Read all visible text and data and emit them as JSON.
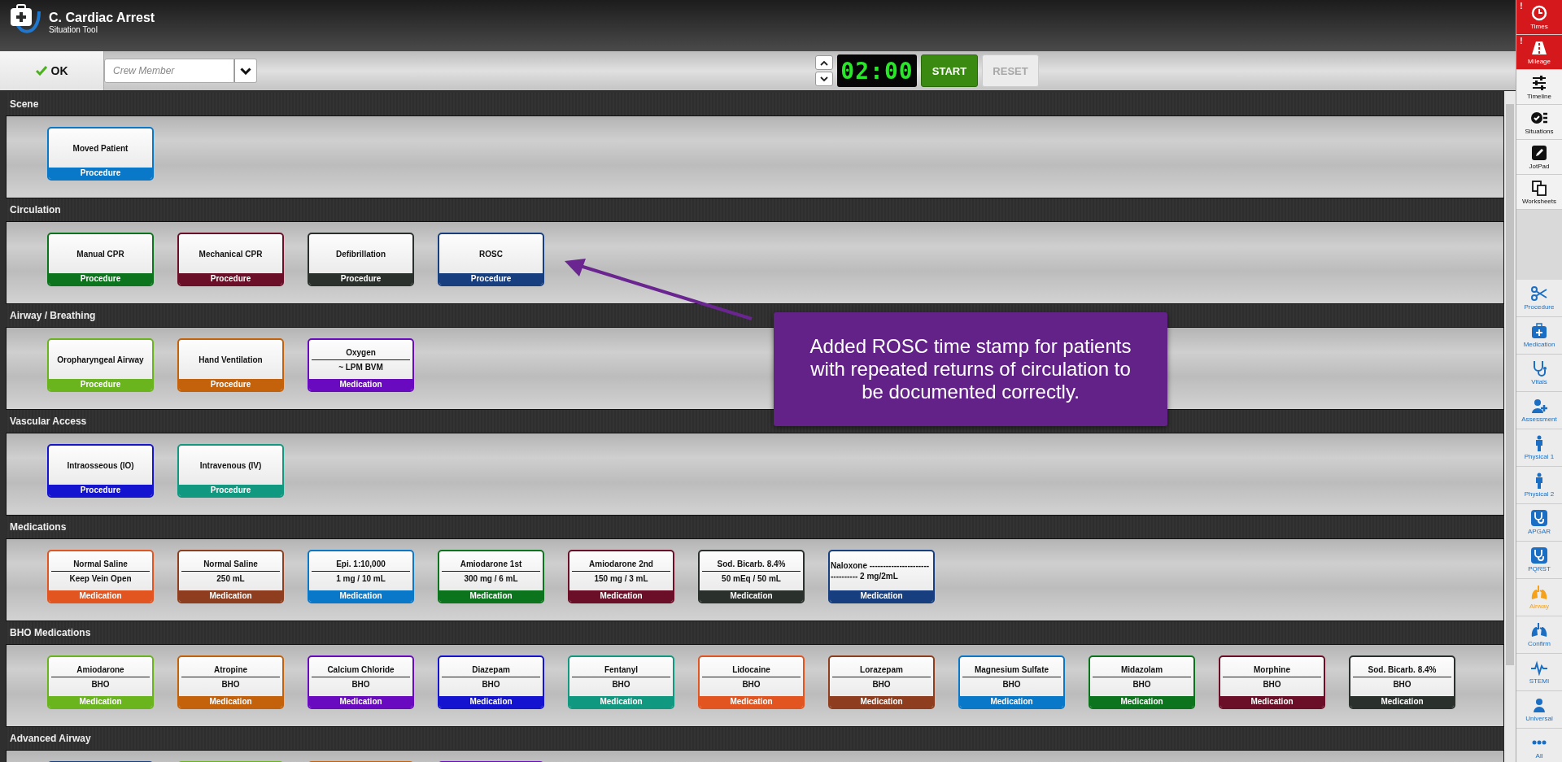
{
  "header": {
    "title": "C. Cardiac Arrest",
    "subtitle": "Situation Tool"
  },
  "toolbar": {
    "ok_button": "OK",
    "crew_field": {
      "placeholder": "Crew Member"
    },
    "timer": {
      "display": "02:00",
      "start": {
        "label": "START",
        "disabled": false
      },
      "reset": {
        "label": "RESET",
        "disabled": true
      }
    }
  },
  "sections": [
    {
      "title": "Scene",
      "cards": [
        {
          "kind": "single",
          "name": "Moved Patient",
          "type": "Procedure",
          "color": "#0a78c8"
        }
      ]
    },
    {
      "title": "Circulation",
      "cards": [
        {
          "kind": "single",
          "name": "Manual CPR",
          "type": "Procedure",
          "color": "#0c741c"
        },
        {
          "kind": "single",
          "name": "Mechanical CPR",
          "type": "Procedure",
          "color": "#6a0f27"
        },
        {
          "kind": "single",
          "name": "Defibrillation",
          "type": "Procedure",
          "color": "#2a302c"
        },
        {
          "kind": "single",
          "name": "ROSC",
          "type": "Procedure",
          "color": "#173f80"
        }
      ]
    },
    {
      "title": "Airway / Breathing",
      "cards": [
        {
          "kind": "single",
          "name": "Oropharyngeal Airway",
          "type": "Procedure",
          "color": "#6ab41e"
        },
        {
          "kind": "single",
          "name": "Hand Ventilation",
          "type": "Procedure",
          "color": "#c4620c"
        },
        {
          "kind": "dose",
          "name": "Oxygen",
          "dose": "~ LPM BVM",
          "type": "Medication",
          "color": "#6a0ac0"
        }
      ]
    },
    {
      "title": "Vascular Access",
      "cards": [
        {
          "kind": "single",
          "name": "Intraosseous (IO)",
          "type": "Procedure",
          "color": "#1414d0"
        },
        {
          "kind": "single",
          "name": "Intravenous (IV)",
          "type": "Procedure",
          "color": "#119880"
        }
      ]
    },
    {
      "title": "Medications",
      "cards": [
        {
          "kind": "dose",
          "name": "Normal Saline",
          "dose": "Keep Vein Open",
          "type": "Medication",
          "color": "#e25520"
        },
        {
          "kind": "dose",
          "name": "Normal Saline",
          "dose": "250 mL",
          "type": "Medication",
          "color": "#8e3e1e"
        },
        {
          "kind": "dose",
          "name": "Epi. 1:10,000",
          "dose": "1 mg / 10 mL",
          "type": "Medication",
          "color": "#0a78c8"
        },
        {
          "kind": "dose",
          "name": "Amiodarone 1st",
          "dose": "300 mg / 6 mL",
          "type": "Medication",
          "color": "#0c741c"
        },
        {
          "kind": "dose",
          "name": "Amiodarone 2nd",
          "dose": "150 mg / 3 mL",
          "type": "Medication",
          "color": "#6a0f27"
        },
        {
          "kind": "dose",
          "name": "Sod. Bicarb. 8.4%",
          "dose": "50 mEq / 50 mL",
          "type": "Medication",
          "color": "#2a302c"
        },
        {
          "kind": "lines",
          "name": "Naloxone ----------------------",
          "dose": "---------- 2 mg/2mL",
          "type": "Medication",
          "color": "#173f80"
        }
      ]
    },
    {
      "title": "BHO Medications",
      "cards": [
        {
          "kind": "dose",
          "name": "Amiodarone",
          "dose": "BHO",
          "type": "Medication",
          "color": "#6ab41e"
        },
        {
          "kind": "dose",
          "name": "Atropine",
          "dose": "BHO",
          "type": "Medication",
          "color": "#c4620c"
        },
        {
          "kind": "dose",
          "name": "Calcium Chloride",
          "dose": "BHO",
          "type": "Medication",
          "color": "#6a0ac0"
        },
        {
          "kind": "dose",
          "name": "Diazepam",
          "dose": "BHO",
          "type": "Medication",
          "color": "#1414d0"
        },
        {
          "kind": "dose",
          "name": "Fentanyl",
          "dose": "BHO",
          "type": "Medication",
          "color": "#119880"
        },
        {
          "kind": "dose",
          "name": "Lidocaine",
          "dose": "BHO",
          "type": "Medication",
          "color": "#e25520"
        },
        {
          "kind": "dose",
          "name": "Lorazepam",
          "dose": "BHO",
          "type": "Medication",
          "color": "#8e3e1e"
        },
        {
          "kind": "dose",
          "name": "Magnesium Sulfate",
          "dose": "BHO",
          "type": "Medication",
          "color": "#0a78c8"
        },
        {
          "kind": "dose",
          "name": "Midazolam",
          "dose": "BHO",
          "type": "Medication",
          "color": "#0c741c"
        },
        {
          "kind": "dose",
          "name": "Morphine",
          "dose": "BHO",
          "type": "Medication",
          "color": "#6a0f27"
        },
        {
          "kind": "dose",
          "name": "Sod. Bicarb. 8.4%",
          "dose": "BHO",
          "type": "Medication",
          "color": "#2a302c"
        }
      ]
    },
    {
      "title": "Advanced Airway",
      "cards": [
        {
          "kind": "stub",
          "color": "#173f80"
        },
        {
          "kind": "stub",
          "color": "#6ab41e"
        },
        {
          "kind": "stub",
          "color": "#c4620c"
        },
        {
          "kind": "stub",
          "color": "#6a0ac0"
        }
      ]
    }
  ],
  "callout": {
    "text": "Added ROSC time stamp for patients with repeated returns of circulation to be documented correctly."
  },
  "sidebar": {
    "top_items": [
      {
        "label": "Times",
        "alert": true,
        "badge": "!"
      },
      {
        "label": "Mileage",
        "alert": true,
        "badge": "!"
      },
      {
        "label": "Timeline",
        "alert": false
      },
      {
        "label": "Situations",
        "alert": false
      },
      {
        "label": "JotPad",
        "alert": false
      },
      {
        "label": "Worksheets",
        "alert": false
      }
    ],
    "tool_items": [
      {
        "label": "Procedure",
        "highlighted": false
      },
      {
        "label": "Medication",
        "highlighted": false
      },
      {
        "label": "Vitals",
        "highlighted": false
      },
      {
        "label": "Assessment",
        "highlighted": false
      },
      {
        "label": "Physical 1",
        "highlighted": false
      },
      {
        "label": "Physical 2",
        "highlighted": false
      },
      {
        "label": "APGAR",
        "highlighted": false
      },
      {
        "label": "PQRST",
        "highlighted": false
      },
      {
        "label": "Airway",
        "highlighted": true
      },
      {
        "label": "Confirm",
        "highlighted": false
      },
      {
        "label": "STEMI",
        "highlighted": false
      },
      {
        "label": "Universal",
        "highlighted": false
      },
      {
        "label": "All",
        "highlighted": false
      }
    ]
  }
}
